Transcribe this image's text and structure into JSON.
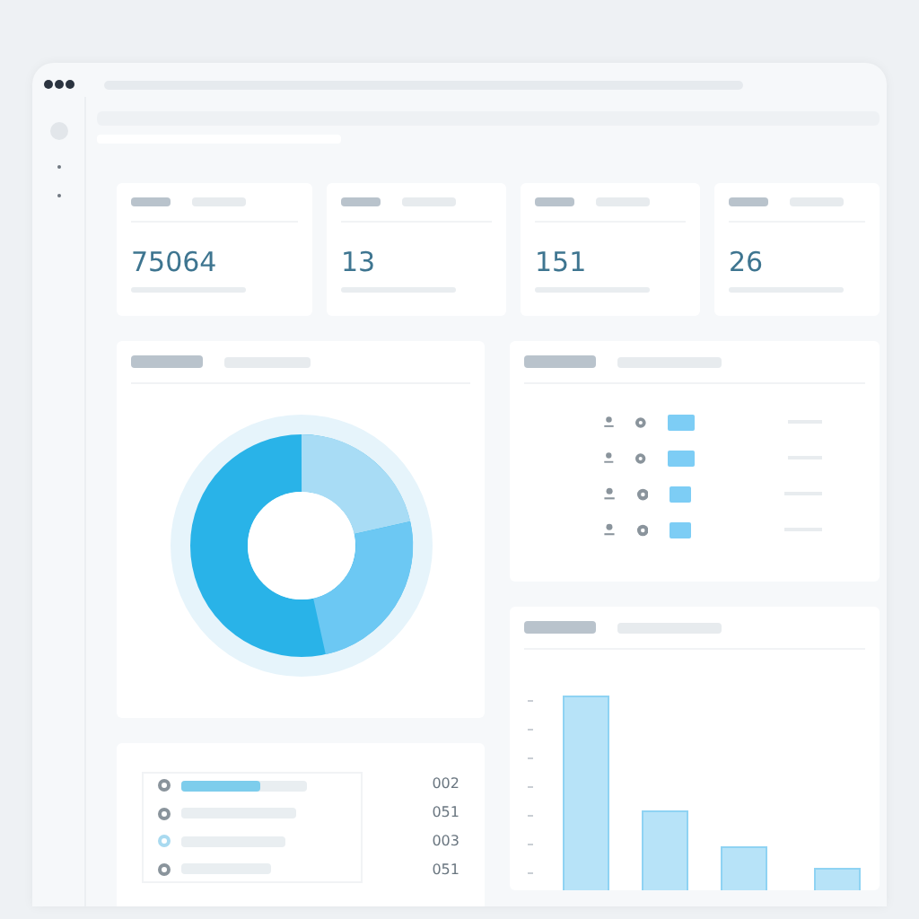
{
  "stats": [
    {
      "value": "75064"
    },
    {
      "value": "13"
    },
    {
      "value": "151"
    },
    {
      "value": "26"
    }
  ],
  "progress_list": [
    {
      "kind": "progress",
      "level": 0.63,
      "color": "#8a949c",
      "value": "002"
    },
    {
      "kind": "line",
      "color": "#8a949c",
      "value": "051"
    },
    {
      "kind": "line",
      "color": "#a9daf0",
      "value": "003"
    },
    {
      "kind": "line",
      "color": "#8a949c",
      "value": "051"
    }
  ]
}
